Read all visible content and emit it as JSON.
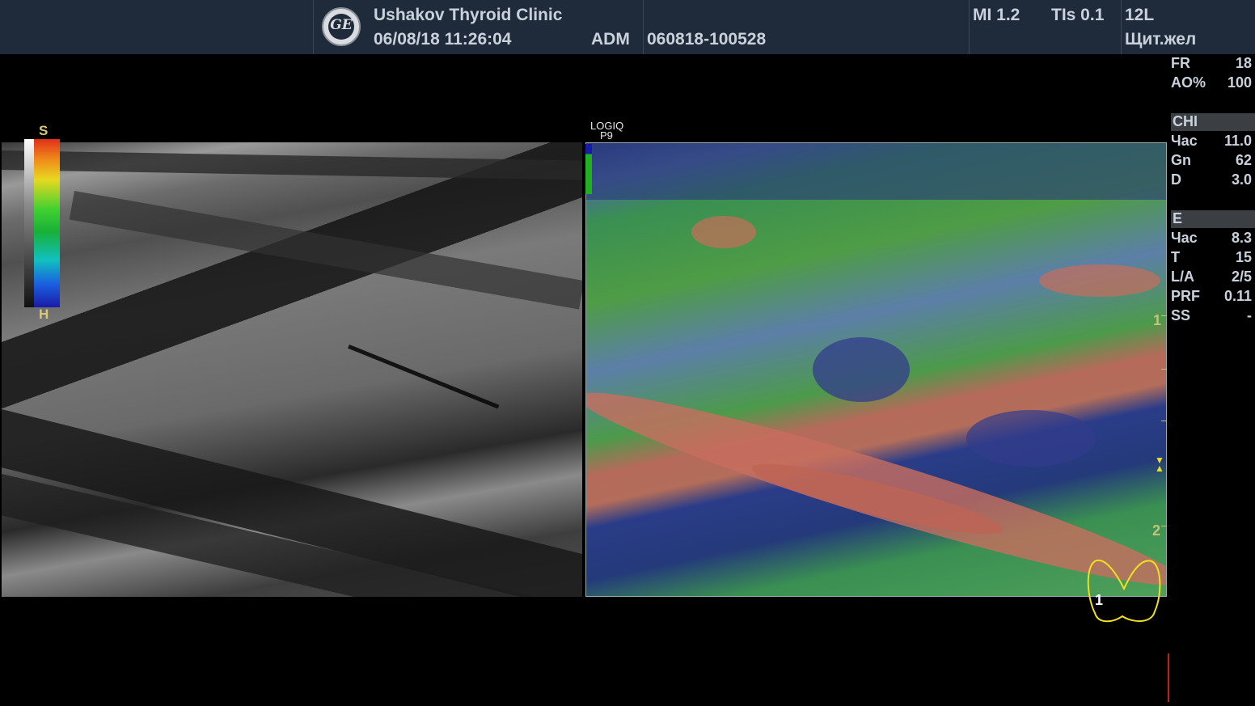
{
  "header": {
    "clinic": "Ushakov Thyroid Clinic",
    "datetime": "06/08/18 11:26:04",
    "operator": "ADM",
    "exam_id": "060818-100528",
    "mi": "MI 1.2",
    "tis": "TIs 0.1",
    "probe": "12L",
    "preset": "Щит.жел",
    "logo_text": "GE"
  },
  "params_top": [
    {
      "key": "FR",
      "value": "18"
    },
    {
      "key": "AO%",
      "value": "100"
    }
  ],
  "chi": {
    "title": "CHI",
    "rows": [
      {
        "key": "Час",
        "value": "11.0"
      },
      {
        "key": "Gn",
        "value": "62"
      },
      {
        "key": "D",
        "value": "3.0"
      }
    ]
  },
  "elasto": {
    "title": "E",
    "rows": [
      {
        "key": "Час",
        "value": "8.3"
      },
      {
        "key": "T",
        "value": "15"
      },
      {
        "key": "L/A",
        "value": "2/5"
      },
      {
        "key": "PRF",
        "value": "0.11"
      },
      {
        "key": "SS",
        "value": "-"
      }
    ]
  },
  "colorbar": {
    "top_label": "S",
    "bottom_label": "H"
  },
  "device": {
    "line1": "LOGIQ",
    "line2": "P9"
  },
  "depth_marks": [
    "1",
    "2"
  ],
  "body_marker_index": "1"
}
